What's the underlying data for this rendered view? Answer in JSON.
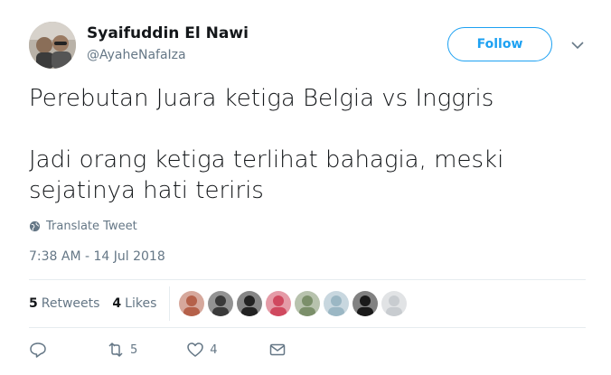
{
  "author": {
    "display_name": "Syaifuddin El Nawi",
    "handle": "@AyaheNafaIza"
  },
  "follow_label": "Follow",
  "tweet": {
    "line1": "Perebutan Juara ketiga Belgia vs Inggris",
    "line2": "Jadi orang ketiga terlihat bahagia, meski\nsejatinya hati teriris"
  },
  "translate_label": "Translate Tweet",
  "timestamp": "7:38 AM - 14 Jul 2018",
  "stats": {
    "retweets_count": "5",
    "retweets_label": "Retweets",
    "likes_count": "4",
    "likes_label": "Likes"
  },
  "likers": [
    {
      "icon": "liker-avatar",
      "color": "#b5614a"
    },
    {
      "icon": "liker-avatar",
      "color": "#3a3a3a"
    },
    {
      "icon": "liker-avatar",
      "color": "#222222"
    },
    {
      "icon": "liker-avatar",
      "color": "#d0495f"
    },
    {
      "icon": "liker-avatar",
      "color": "#7b8f6a"
    },
    {
      "icon": "liker-avatar",
      "color": "#9bb7c4"
    },
    {
      "icon": "liker-avatar",
      "color": "#1a1a1a"
    },
    {
      "icon": "liker-avatar",
      "color": "#c8ccd0"
    }
  ],
  "actions": {
    "reply_icon": "reply-icon",
    "retweet_icon": "retweet-icon",
    "retweet_count": "5",
    "like_icon": "heart-icon",
    "like_count": "4",
    "dm_icon": "envelope-icon"
  },
  "colors": {
    "accent": "#1da1f2",
    "secondary_text": "#657786",
    "divider": "#e6ecf0"
  }
}
